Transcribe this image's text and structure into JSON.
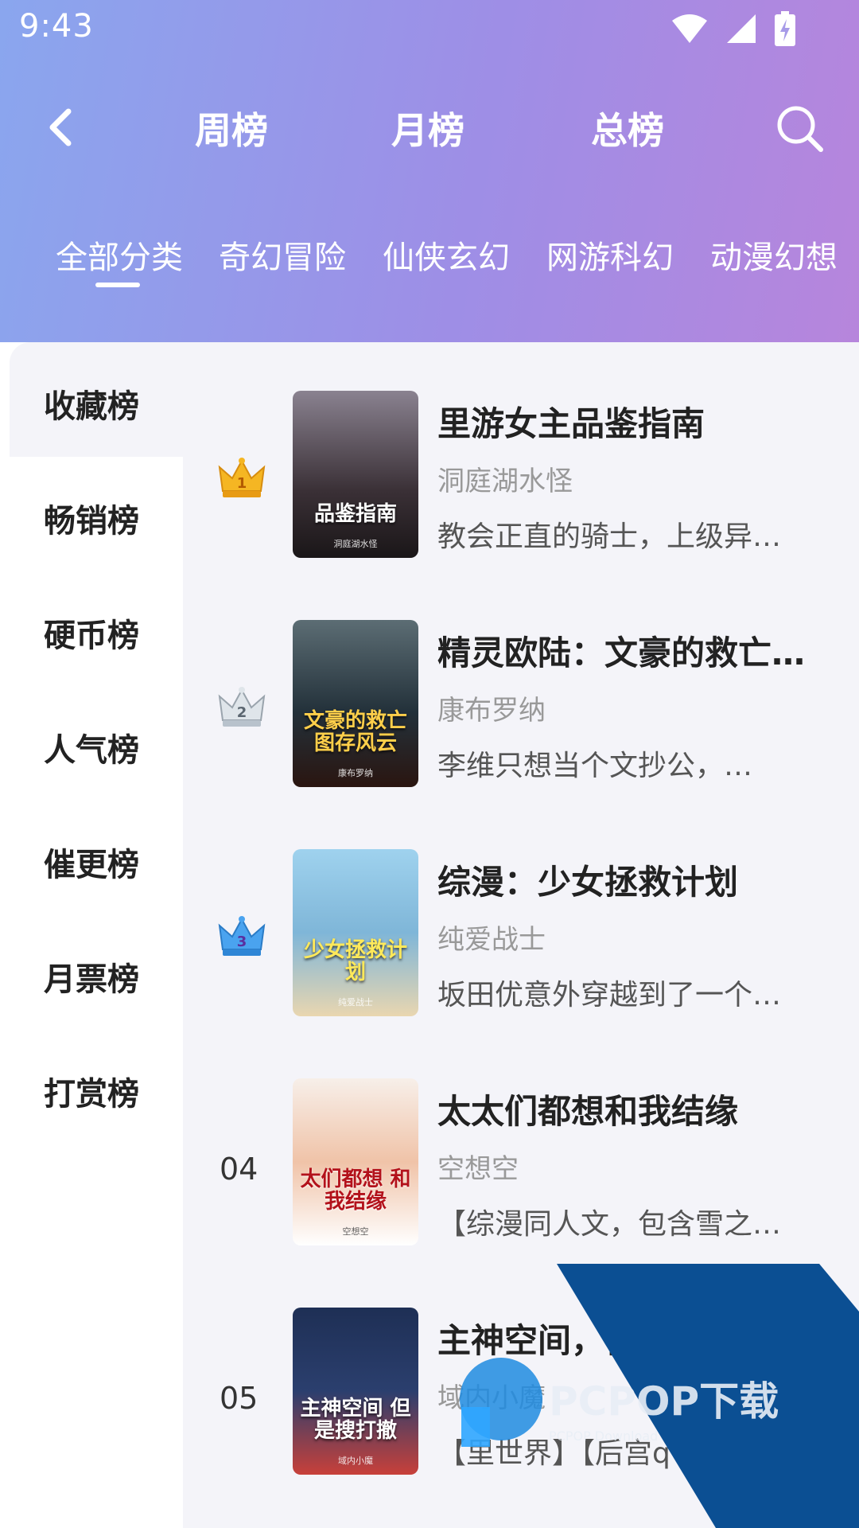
{
  "status_bar": {
    "time": "9:43"
  },
  "top_nav": {
    "tabs": [
      {
        "label": "周榜"
      },
      {
        "label": "月榜"
      },
      {
        "label": "总榜"
      }
    ]
  },
  "categories": {
    "items": [
      "全部分类",
      "奇幻冒险",
      "仙侠玄幻",
      "网游科幻",
      "动漫幻想"
    ],
    "selected_index": 0
  },
  "sidebar": {
    "items": [
      "收藏榜",
      "畅销榜",
      "硬币榜",
      "人气榜",
      "催更榜",
      "月票榜",
      "打赏榜"
    ],
    "selected_index": 0
  },
  "books": [
    {
      "rank": "1",
      "title": "里游女主品鉴指南",
      "author": "洞庭湖水怪",
      "desc": "教会正直的骑士，上级异…",
      "cover_text": "品鉴指南",
      "cover_author": "洞庭湖水怪",
      "cover_color": "#3a3036"
    },
    {
      "rank": "2",
      "title": "精灵欧陆：文豪的救亡…",
      "author": "康布罗纳",
      "desc": "  李维只想当个文抄公，…",
      "cover_text": "文豪的救亡 图存风云",
      "cover_author": "康布罗纳",
      "cover_color": "#23313a"
    },
    {
      "rank": "3",
      "title": "综漫：少女拯救计划",
      "author": "纯爱战士",
      "desc": "坂田优意外穿越到了一个…",
      "cover_text": "少女拯救计划",
      "cover_author": "纯爱战士",
      "cover_color": "#7fb6d8"
    },
    {
      "rank": "04",
      "title": "太太们都想和我结缘",
      "author": "空想空",
      "desc": "【综漫同人文，包含雪之…",
      "cover_text": "太们都想 和我结缘",
      "cover_author": "空想空",
      "cover_color": "#efe6e0"
    },
    {
      "rank": "05",
      "title": "主神空间，但",
      "author": "域内小魔",
      "desc": "【里世界】【后宫q",
      "cover_text": "主神空间 但是搜打撤",
      "cover_author": "域内小魔",
      "cover_color": "#2b3f6e"
    }
  ],
  "colors": {
    "header_gradient_start": "#8aa6ee",
    "header_gradient_end": "#b785dc",
    "crown_gold": "#f5b623",
    "crown_silver": "#b8c2cc",
    "crown_blue": "#4aa3ef"
  },
  "watermark": {
    "brand": "PCPOP下载",
    "sub": "PCPOP Download"
  }
}
